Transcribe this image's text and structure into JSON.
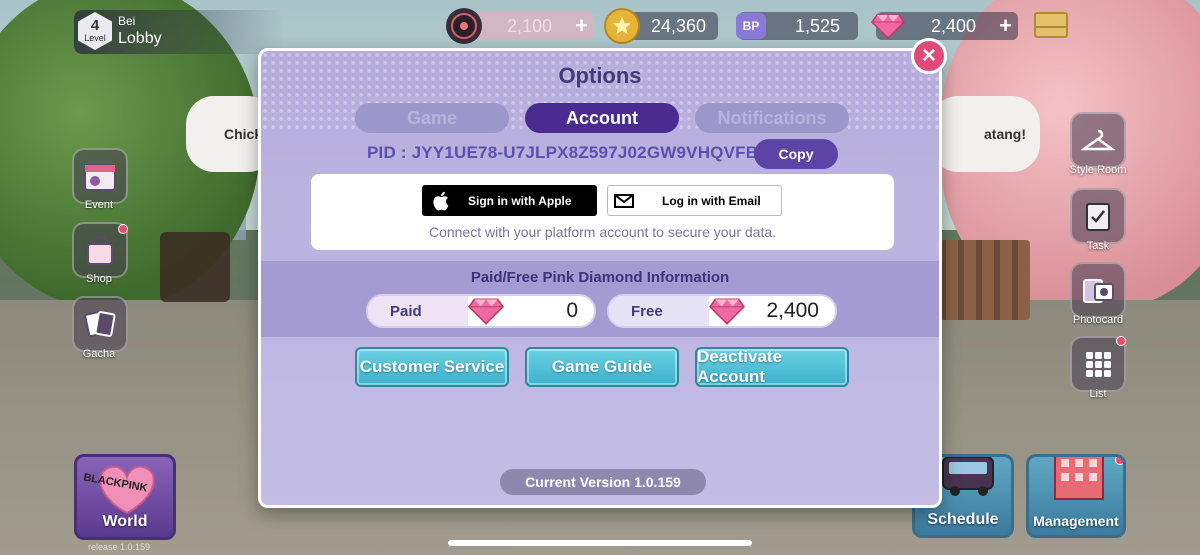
{
  "hud": {
    "level": "4",
    "level_word": "Level",
    "player_name": "Bei",
    "location": "Lobby",
    "currencies": [
      {
        "id": "record",
        "value": "2,100",
        "icon": "vinyl-record-icon",
        "has_plus": true
      },
      {
        "id": "star-coin",
        "value": "24,360",
        "icon": "star-coin-icon",
        "has_plus": false
      },
      {
        "id": "bp",
        "value": "1,525",
        "icon": "bp-ticket-icon",
        "has_plus": false
      },
      {
        "id": "pink-diamond",
        "value": "2,400",
        "icon": "pink-diamond-icon",
        "has_plus": true
      }
    ],
    "plus": "+"
  },
  "background": {
    "bubble_left": "Chick",
    "bubble_right": "atang!"
  },
  "left_menu": [
    {
      "label": "Event",
      "icon": "calendar-icon"
    },
    {
      "label": "Shop",
      "icon": "shopping-bag-icon"
    },
    {
      "label": "Gacha",
      "icon": "cards-icon"
    }
  ],
  "right_menu": [
    {
      "label": "Style Room",
      "icon": "hanger-icon"
    },
    {
      "label": "Task",
      "icon": "clipboard-icon"
    },
    {
      "label": "Photocard",
      "icon": "photocard-icon"
    },
    {
      "label": "List",
      "icon": "grid-icon"
    }
  ],
  "bottom": {
    "world_label": "World",
    "world_logo": "BLACKPINK",
    "release": "release 1.0.159",
    "schedule_label": "Schedule",
    "management_label": "Management"
  },
  "modal": {
    "title": "Options",
    "close": "×",
    "tabs": [
      {
        "label": "Game",
        "active": false
      },
      {
        "label": "Account",
        "active": true
      },
      {
        "label": "Notifications",
        "active": false
      }
    ],
    "pid": "PID : JYY1UE78-U7JLPX8Z597J02GW9VHQVFB",
    "copy_label": "Copy",
    "apple_label": "Sign in with Apple",
    "email_label": "Log in with Email",
    "connect_text": "Connect with your platform account to secure your data.",
    "diamond_title": "Paid/Free Pink Diamond Information",
    "paid_label": "Paid",
    "paid_value": "0",
    "free_label": "Free",
    "free_value": "2,400",
    "actions": [
      "Customer Service",
      "Game Guide",
      "Deactivate Account"
    ],
    "version": "Current Version 1.0.159"
  },
  "colors": {
    "modal_bg": "#b6addc",
    "tab_active": "#4a2b90",
    "action_button": "#3db1cb",
    "close_button": "#e04a78"
  }
}
